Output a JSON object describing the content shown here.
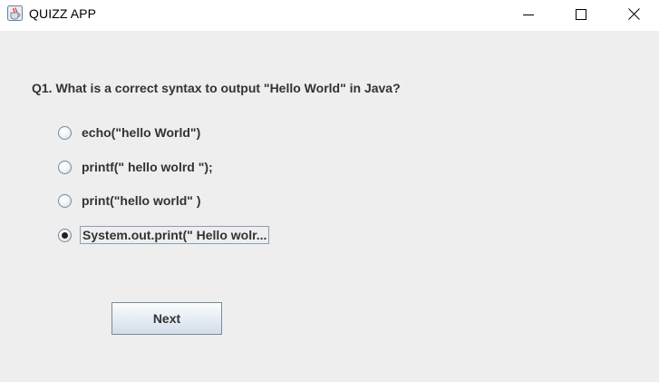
{
  "window": {
    "title": "QUIZZ APP",
    "icon": "java-coffee-cup-icon",
    "controls": [
      "minimize-icon",
      "maximize-icon",
      "close-icon"
    ]
  },
  "quiz": {
    "question": "Q1. What is a correct syntax to output \"Hello World\" in Java?",
    "options": [
      {
        "label": "echo(\"hello World\")",
        "selected": false
      },
      {
        "label": "printf(\" hello wolrd \");",
        "selected": false
      },
      {
        "label": "print(\"hello world\" )",
        "selected": false
      },
      {
        "label": "System.out.print(\" Hello wolr...",
        "selected": true
      }
    ],
    "next_label": "Next"
  }
}
